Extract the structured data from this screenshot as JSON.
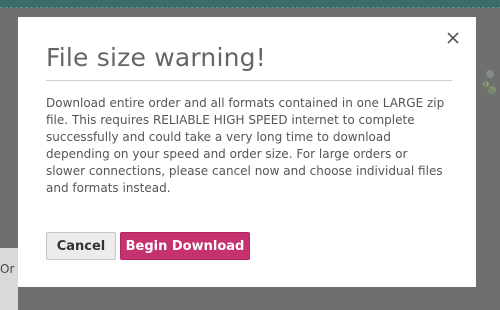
{
  "background": {
    "left_text": "Or"
  },
  "modal": {
    "title": "File size warning!",
    "message": "Download entire order and all formats contained in one LARGE zip file. This requires RELIABLE HIGH SPEED internet to complete successfully and could take a very long time to download depending on your speed and order size. For large orders or slower connections, please cancel now and choose individual files and formats instead.",
    "close_icon": "close-icon",
    "buttons": {
      "cancel_label": "Cancel",
      "begin_label": "Begin Download"
    }
  },
  "colors": {
    "overlay": "#6f6f6f",
    "primary_button": "#c6326f",
    "title_text": "#666666",
    "body_text": "#555555"
  }
}
